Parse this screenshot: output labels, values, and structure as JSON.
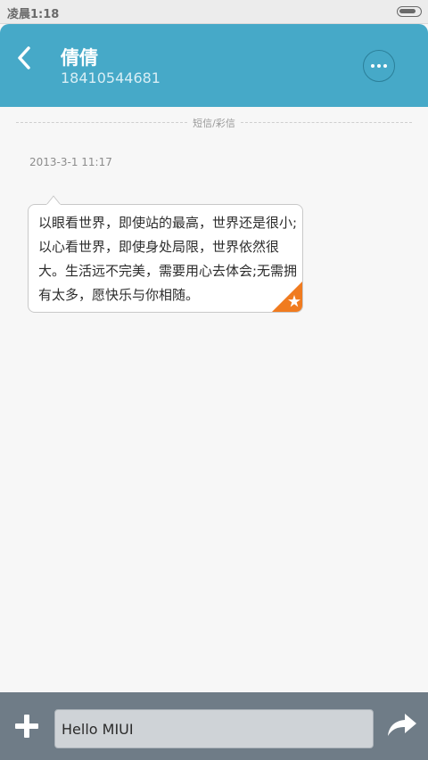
{
  "status_bar": {
    "time": "凌晨1:18",
    "battery_level": 0.85
  },
  "header": {
    "contact_name": "倩倩",
    "contact_number": "18410544681"
  },
  "conversation": {
    "channel_label": "短信/彩信",
    "messages": [
      {
        "timestamp": "2013-3-1 11:17",
        "text": "以眼看世界，即使站的最高，世界还是很小;以心看世界，即使身处局限，世界依然很大。生活远不完美，需要用心去体会;无需拥有太多，愿快乐与你相随。",
        "starred": true
      }
    ]
  },
  "composer": {
    "input_value": "Hello MIUI"
  },
  "colors": {
    "header_bg": "#46a9c8",
    "star_badge": "#f07b1f",
    "bottom_bar_bg": "#6f7c87"
  },
  "icons": {
    "back": "back-arrow-icon",
    "more": "more-dots-icon",
    "star": "star-icon",
    "add": "plus-icon",
    "send": "send-arrow-icon"
  }
}
